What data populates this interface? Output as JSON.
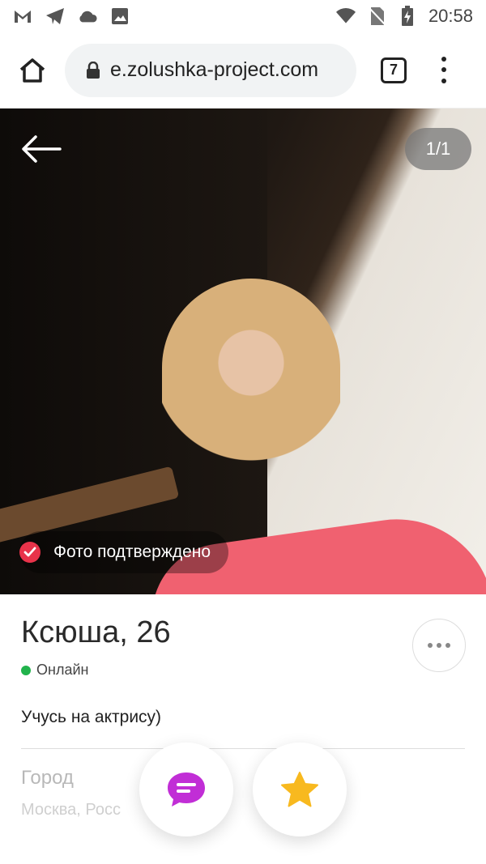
{
  "status_bar": {
    "time": "20:58",
    "icons": [
      "gmail-icon",
      "telegram-icon",
      "cloud-icon",
      "image-icon",
      "wifi-icon",
      "no-sim-icon",
      "battery-charging-icon"
    ]
  },
  "browser": {
    "url": "e.zolushka-project.com",
    "tab_count": "7",
    "icons": [
      "home-icon",
      "lock-icon",
      "menu-dots-icon"
    ]
  },
  "photo": {
    "counter": "1/1",
    "verified_label": "Фото подтверждено",
    "icons": [
      "back-arrow-icon",
      "check-icon"
    ]
  },
  "profile": {
    "name_age": "Ксюша, 26",
    "status": "Онлайн",
    "bio": "Учусь на актрису)",
    "city_label": "Город",
    "city_value": "Москва, Росс"
  },
  "actions": {
    "icons": [
      "more-icon",
      "chat-icon",
      "star-icon"
    ]
  },
  "colors": {
    "accent": "#e8334a",
    "online": "#21b34c",
    "chat": "#c12ed6",
    "star": "#f8b91f"
  }
}
